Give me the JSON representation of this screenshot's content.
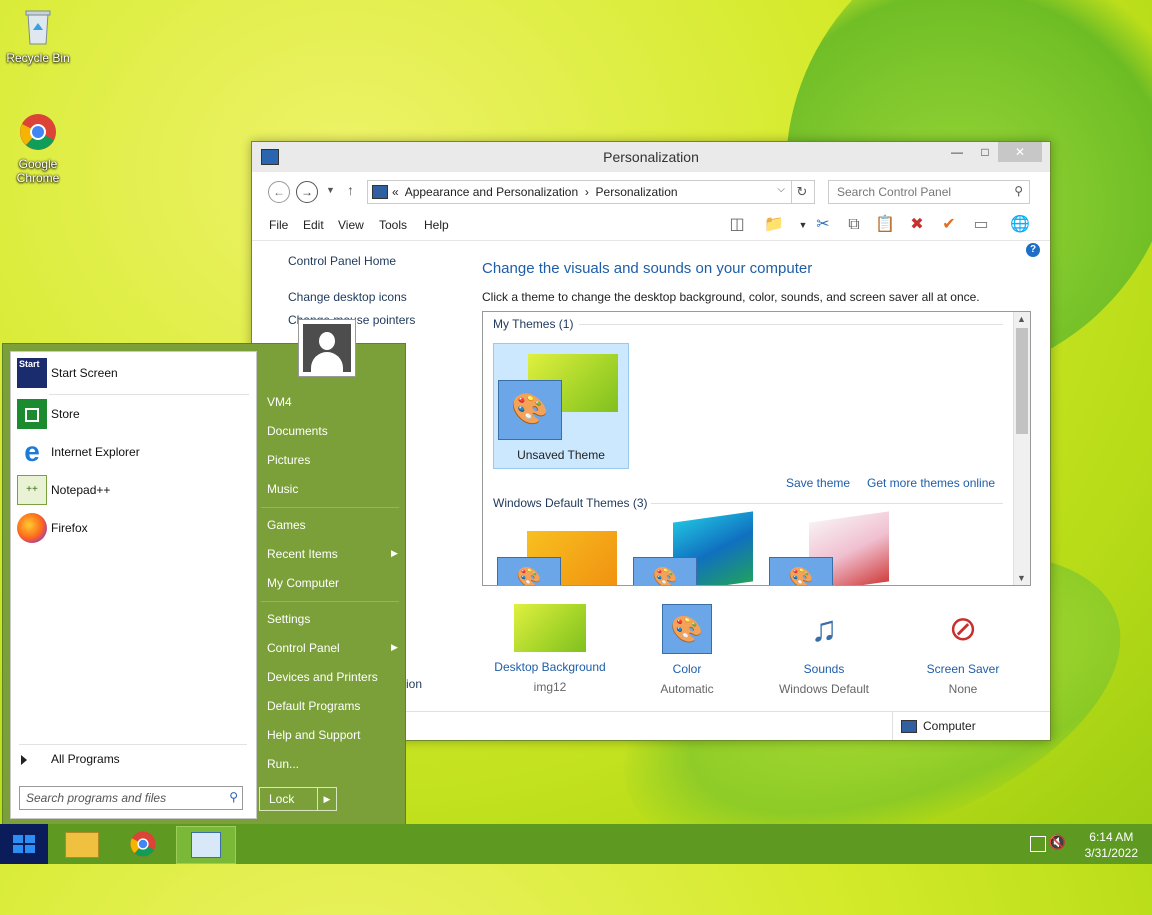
{
  "desktop": {
    "icons": [
      {
        "label": "Recycle Bin"
      },
      {
        "label": "Google Chrome"
      }
    ]
  },
  "window": {
    "title": "Personalization",
    "controls": {
      "minimize": "—",
      "maximize": "□",
      "close": "✕"
    },
    "address": {
      "prefix": "«",
      "crumb1": "Appearance and Personalization",
      "sep": "›",
      "crumb2": "Personalization"
    },
    "search_placeholder": "Search Control Panel",
    "menu": [
      "File",
      "Edit",
      "View",
      "Tools",
      "Help"
    ],
    "left_links": [
      "Control Panel Home",
      "Change desktop icons",
      "Change mouse pointers",
      "...ion"
    ],
    "heading": "Change the visuals and sounds on your computer",
    "subheading": "Click a theme to change the desktop background, color, sounds, and screen saver all at once.",
    "themes": {
      "my_themes_label": "My Themes (1)",
      "selected_theme": "Unsaved Theme",
      "save_theme": "Save theme",
      "get_more": "Get more themes online",
      "default_label": "Windows Default Themes (3)"
    },
    "bottom_items": [
      {
        "label": "Desktop Background",
        "value": "img12"
      },
      {
        "label": "Color",
        "value": "Automatic"
      },
      {
        "label": "Sounds",
        "value": "Windows Default"
      },
      {
        "label": "Screen Saver",
        "value": "None"
      }
    ],
    "status": "Computer",
    "help": "?"
  },
  "start_menu": {
    "pinned": [
      {
        "label": "Start Screen",
        "icon": "start-screen-icon"
      },
      {
        "label": "Store",
        "icon": "store-icon"
      },
      {
        "label": "Internet Explorer",
        "icon": "ie-icon"
      },
      {
        "label": "Notepad++",
        "icon": "notepadpp-icon"
      },
      {
        "label": "Firefox",
        "icon": "firefox-icon"
      }
    ],
    "start_tile_text": "Start",
    "all_programs": "All Programs",
    "search_placeholder": "Search programs and files",
    "right_items": [
      "VM4",
      "Documents",
      "Pictures",
      "Music",
      "Games",
      "Recent Items",
      "My Computer",
      "Settings",
      "Control Panel",
      "Devices and Printers",
      "Default Programs",
      "Help and Support",
      "Run..."
    ],
    "lock": "Lock"
  },
  "taskbar": {
    "time": "6:14 AM",
    "date": "3/31/2022"
  }
}
